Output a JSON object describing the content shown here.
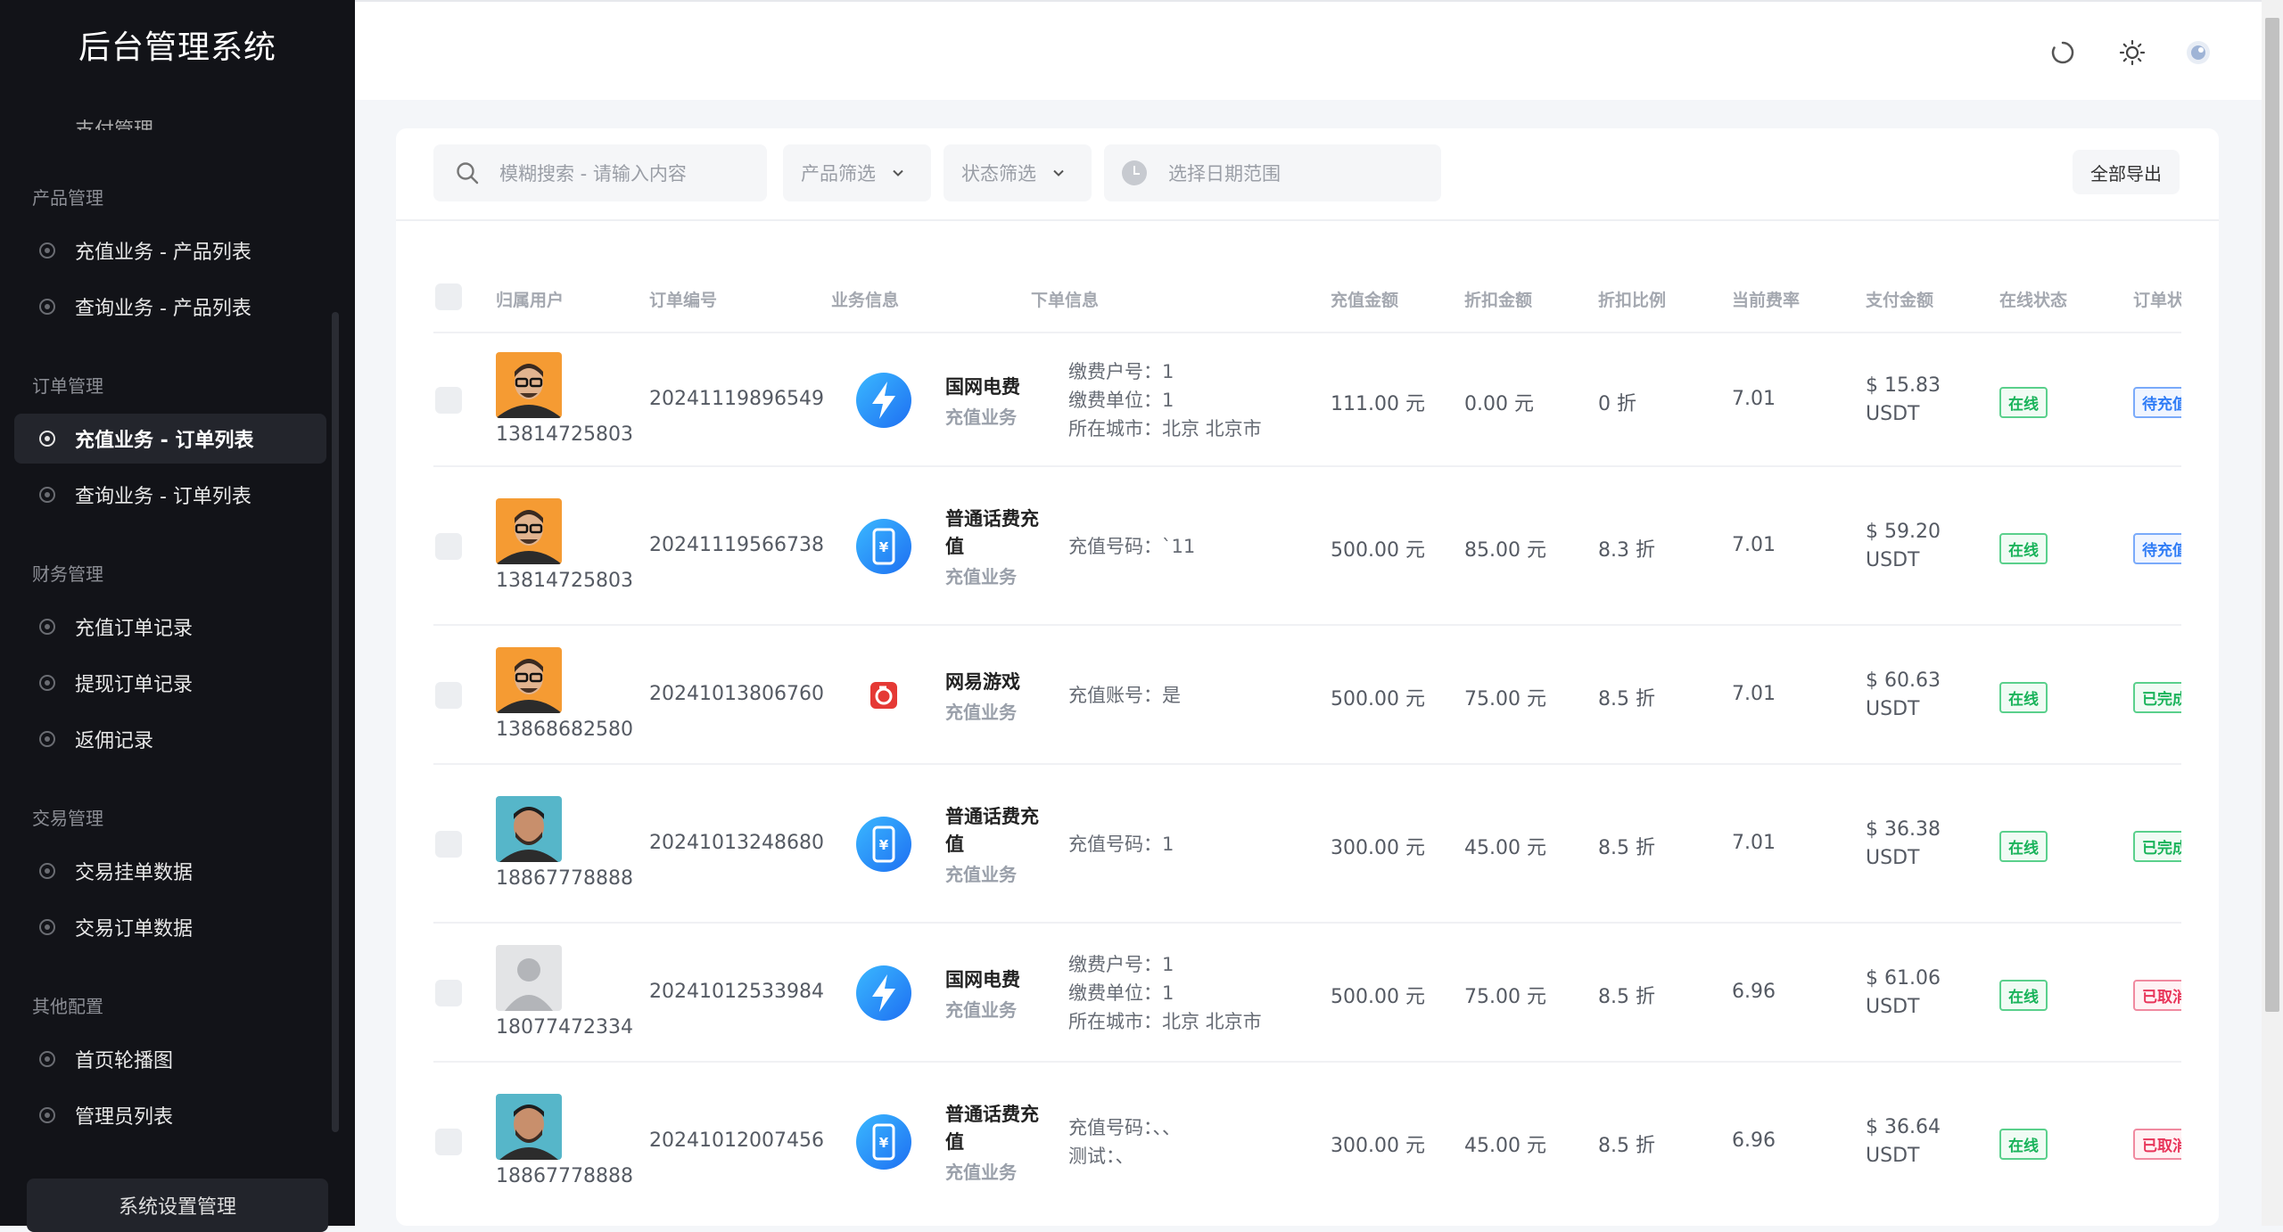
{
  "brand": "后台管理系统",
  "sidebar": {
    "cut_label": "支付管理",
    "groups": [
      {
        "title": "产品管理",
        "items": [
          "充值业务 - 产品列表",
          "查询业务 - 产品列表"
        ]
      },
      {
        "title": "订单管理",
        "items": [
          "充值业务 - 订单列表",
          "查询业务 - 订单列表"
        ]
      },
      {
        "title": "财务管理",
        "items": [
          "充值订单记录",
          "提现订单记录",
          "返佣记录"
        ]
      },
      {
        "title": "交易管理",
        "items": [
          "交易挂单数据",
          "交易订单数据"
        ]
      },
      {
        "title": "其他配置",
        "items": [
          "首页轮播图",
          "管理员列表"
        ]
      }
    ],
    "bottom_button": "系统设置管理"
  },
  "header": {
    "icons": [
      "refresh-icon",
      "sun-icon",
      "user-avatar-icon"
    ]
  },
  "toolbar": {
    "search_placeholder": "模糊搜索 - 请输入内容",
    "product_filter": "产品筛选",
    "status_filter": "状态筛选",
    "date_placeholder": "选择日期范围",
    "export_label": "全部导出"
  },
  "table": {
    "columns": [
      "归属用户",
      "订单编号",
      "业务信息",
      "下单信息",
      "充值金额",
      "折扣金额",
      "折扣比例",
      "当前费率",
      "支付金额",
      "在线状态",
      "订单状态"
    ],
    "rows": [
      {
        "phone": "13814725803",
        "avatar": "glasses",
        "order": "20241119896549",
        "biz_icon": "lightning",
        "biz": "国网电费",
        "biz_type": "充值业务",
        "info": [
          "缴费户号：1",
          "缴费单位：1",
          "所在城市：北京 北京市"
        ],
        "amount": "111.00 元",
        "discount": "0.00 元",
        "ratio": "0 折",
        "rate": "7.01",
        "pay1": "$ 15.83",
        "pay2": "USDT",
        "online": "在线",
        "status": "待充值",
        "status_color": "blue"
      },
      {
        "phone": "13814725803",
        "avatar": "glasses",
        "order": "20241119566738",
        "biz_icon": "phone",
        "biz": "普通话费充值",
        "biz_type": "充值业务",
        "info": [
          "充值号码：`11"
        ],
        "amount": "500.00 元",
        "discount": "85.00 元",
        "ratio": "8.3 折",
        "rate": "7.01",
        "pay1": "$ 59.20",
        "pay2": "USDT",
        "online": "在线",
        "status": "待充值",
        "status_color": "blue"
      },
      {
        "phone": "13868682580",
        "avatar": "glasses",
        "order": "20241013806760",
        "biz_icon": "netease",
        "biz": "网易游戏",
        "biz_type": "充值业务",
        "info": [
          "充值账号：是"
        ],
        "amount": "500.00 元",
        "discount": "75.00 元",
        "ratio": "8.5 折",
        "rate": "7.01",
        "pay1": "$ 60.63",
        "pay2": "USDT",
        "online": "在线",
        "status": "已完成",
        "status_color": "green"
      },
      {
        "phone": "18867778888",
        "avatar": "man",
        "order": "20241013248680",
        "biz_icon": "phone",
        "biz": "普通话费充值",
        "biz_type": "充值业务",
        "info": [
          "充值号码：1"
        ],
        "amount": "300.00 元",
        "discount": "45.00 元",
        "ratio": "8.5 折",
        "rate": "7.01",
        "pay1": "$ 36.38",
        "pay2": "USDT",
        "online": "在线",
        "status": "已完成",
        "status_color": "green"
      },
      {
        "phone": "18077472334",
        "avatar": "default",
        "order": "20241012533984",
        "biz_icon": "lightning",
        "biz": "国网电费",
        "biz_type": "充值业务",
        "info": [
          "缴费户号：1",
          "缴费单位：1",
          "所在城市：北京 北京市"
        ],
        "amount": "500.00 元",
        "discount": "75.00 元",
        "ratio": "8.5 折",
        "rate": "6.96",
        "pay1": "$ 61.06",
        "pay2": "USDT",
        "online": "在线",
        "status": "已取消",
        "status_color": "red"
      },
      {
        "phone": "18867778888",
        "avatar": "man",
        "order": "20241012007456",
        "biz_icon": "phone",
        "biz": "普通话费充值",
        "biz_type": "充值业务",
        "info": [
          "充值号码：、、",
          "测试：、"
        ],
        "amount": "300.00 元",
        "discount": "45.00 元",
        "ratio": "8.5 折",
        "rate": "6.96",
        "pay1": "$ 36.64",
        "pay2": "USDT",
        "online": "在线",
        "status": "已取消",
        "status_color": "red"
      }
    ]
  }
}
